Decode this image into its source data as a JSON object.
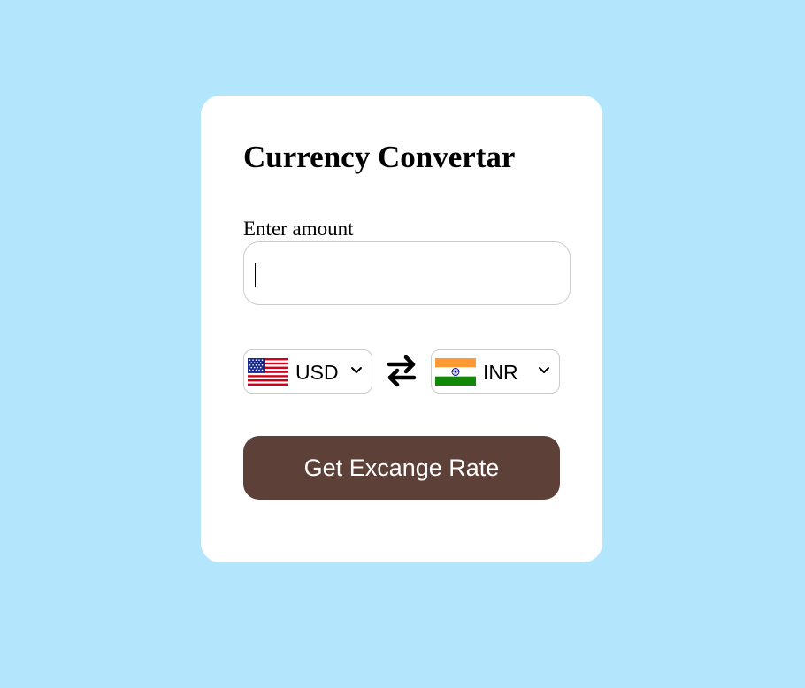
{
  "converter": {
    "title": "Currency Convertar",
    "amount_label": "Enter amount",
    "amount_value": "",
    "from": {
      "code": "USD",
      "flag": "us-flag-icon"
    },
    "to": {
      "code": "INR",
      "flag": "in-flag-icon"
    },
    "swap_icon": "swap-arrows-icon",
    "button_label": "Get Excange Rate"
  },
  "colors": {
    "page_background": "#b3e5fc",
    "card_background": "#ffffff",
    "button_background": "#5d4037",
    "button_text": "#ffffff",
    "border": "#cccccc"
  }
}
